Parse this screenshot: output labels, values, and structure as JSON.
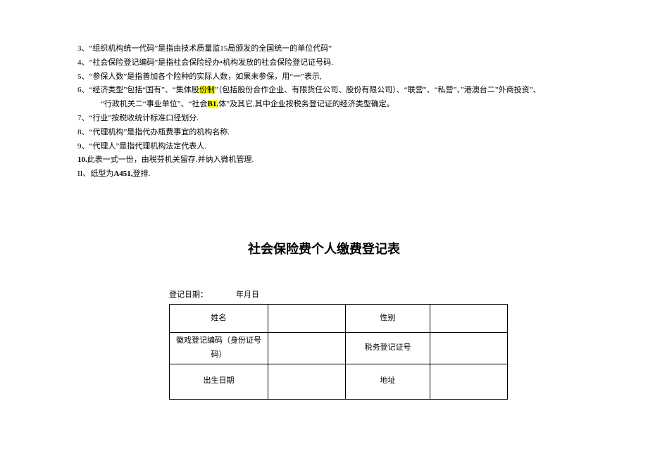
{
  "notes": {
    "n3": "3、“组织机构统一代码”是指由技术质量监15局颁发的全国统一的单位代码“",
    "n4": "4、“社会保险登记编码”是指社会保险经办•机构发放的社会保险登记证号码.",
    "n5": "5、“参保人数”是指善加各个险种的实际人数，如果未参保，用“一”表示,",
    "n6a_prefix": "6、“经济类型”包括“国有”、“集体股",
    "n6a_hl": "份制",
    "n6a_suffix": "”（包括股份合作企业、有限货任公司、股份有限公司）、“联营”、“私营”、”港澳台二”外商投资”、",
    "n6b_prefix": "“行政机关二“事业单位”、“社会",
    "n6b_bold": "B1.",
    "n6b_suffix": "体”及其它,其中企业按税务登记证的经济类型确定。",
    "n7": "7、“行业”按税收统计标准口径划分.",
    "n8": "8、“代理机构”是指代办瓶费事宜的机构名称.",
    "n9": "9、“代理人”是指代理机构法定代表人.",
    "n10_prefix": "10.",
    "n10_rest": "此表一式一份，由税芬机关留存.并纳入微机管理.",
    "n11_prefix": "II、纸型为",
    "n11_bold": "A451,",
    "n11_suffix": "登排."
  },
  "title": "社会保险费个人缴费登记表",
  "reg_date": {
    "label": "登记日期：",
    "value": "年月日"
  },
  "table": {
    "r1c1": "姓名",
    "r1c2": "",
    "r1c3": "性别",
    "r1c4": "",
    "r2c1": "徽戏登记编码（身份证号码）",
    "r2c2": "",
    "r2c3": "税务登记证号",
    "r2c4": "",
    "r3c1": "出生日期",
    "r3c2": "",
    "r3c3": "地址",
    "r3c4": ""
  }
}
